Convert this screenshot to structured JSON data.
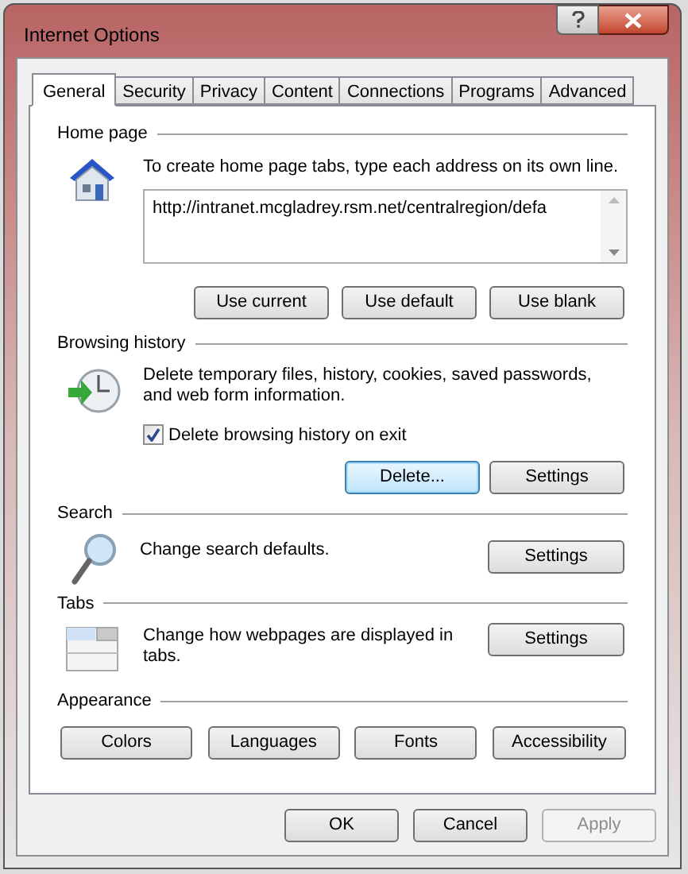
{
  "window": {
    "title": "Internet Options"
  },
  "tabs": [
    {
      "label": "General",
      "selected": true
    },
    {
      "label": "Security",
      "selected": false
    },
    {
      "label": "Privacy",
      "selected": false
    },
    {
      "label": "Content",
      "selected": false
    },
    {
      "label": "Connections",
      "selected": false
    },
    {
      "label": "Programs",
      "selected": false
    },
    {
      "label": "Advanced",
      "selected": false
    }
  ],
  "home_page": {
    "title": "Home page",
    "description": "To create home page tabs, type each address on its own line.",
    "address": "http://intranet.mcgladrey.rsm.net/centralregion/defa",
    "buttons": [
      {
        "label": "Use current",
        "focused": false
      },
      {
        "label": "Use default",
        "focused": false
      },
      {
        "label": "Use blank",
        "focused": false
      }
    ]
  },
  "browsing_history": {
    "title": "Browsing history",
    "description": "Delete temporary files, history, cookies, saved passwords, and web form information.",
    "checkbox": {
      "label": "Delete browsing history on exit",
      "checked": true
    },
    "buttons": [
      {
        "label": "Delete...",
        "focused": true
      },
      {
        "label": "Settings",
        "focused": false
      }
    ]
  },
  "search": {
    "title": "Search",
    "description": "Change search defaults.",
    "button": {
      "label": "Settings",
      "focused": false
    }
  },
  "tabs_section": {
    "title": "Tabs",
    "description": "Change how webpages are displayed in tabs.",
    "button": {
      "label": "Settings",
      "focused": false
    }
  },
  "appearance": {
    "title": "Appearance",
    "buttons": [
      {
        "label": "Colors",
        "focused": false
      },
      {
        "label": "Languages",
        "focused": false
      },
      {
        "label": "Fonts",
        "focused": false
      },
      {
        "label": "Accessibility",
        "focused": false
      }
    ]
  },
  "footer_buttons": [
    {
      "label": "OK",
      "disabled": false
    },
    {
      "label": "Cancel",
      "disabled": false
    },
    {
      "label": "Apply",
      "disabled": true
    }
  ]
}
